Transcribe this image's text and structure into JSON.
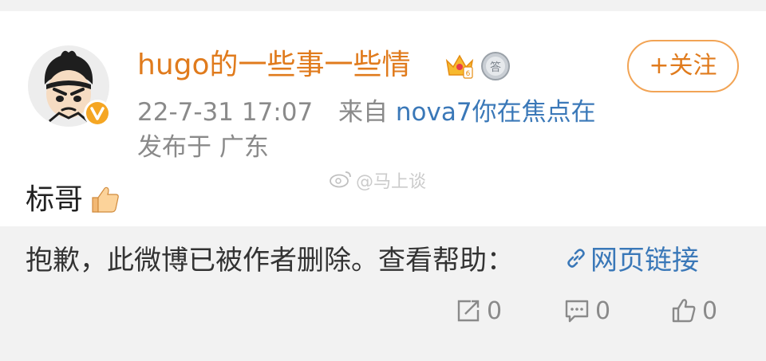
{
  "post": {
    "username": "hugo的一些事一些情",
    "time": "22-7-31 17:07",
    "source_prefix": "来自",
    "source": "nova7你在焦点在",
    "location": "发布于 广东",
    "follow_label": "+关注",
    "text": "标哥",
    "watermark": "@马上谈"
  },
  "deleted_notice": {
    "message": "抱歉，此微博已被作者删除。查看帮助：",
    "link_label": "网页链接"
  },
  "actions": {
    "repost_count": "0",
    "comment_count": "0",
    "like_count": "0"
  },
  "icons": {
    "crown": "crown-icon",
    "medal": "medal-icon",
    "verified": "verified-icon",
    "thumb": "thumbs-up-icon",
    "link": "link-icon",
    "repost": "repost-icon",
    "comment": "comment-icon",
    "like": "like-icon"
  },
  "colors": {
    "accent": "#e07b1d",
    "link": "#3a78b8",
    "muted": "#8a8a8a",
    "verified": "#f5a623"
  }
}
